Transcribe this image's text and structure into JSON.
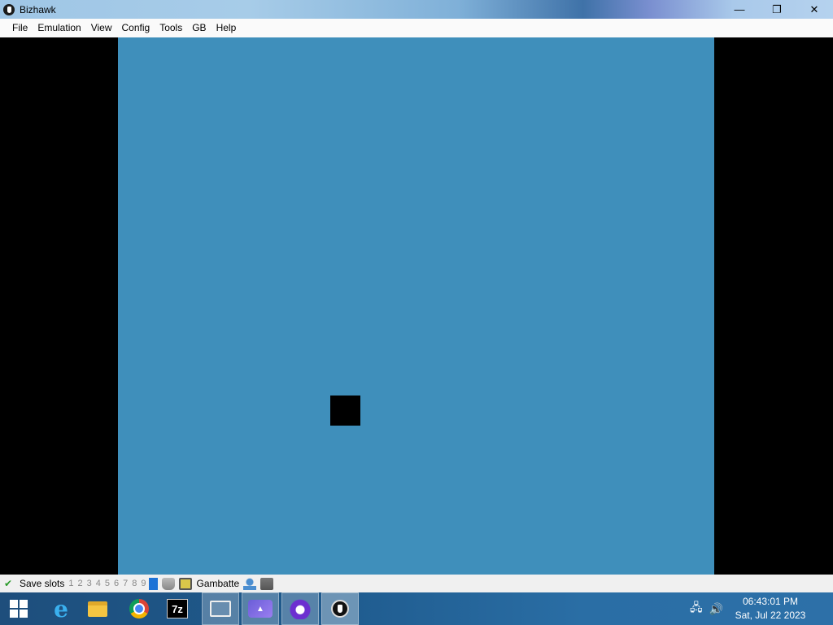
{
  "window": {
    "title": "Bizhawk",
    "controls": {
      "minimize": "—",
      "restore": "❐",
      "close": "✕"
    }
  },
  "menu": {
    "items": [
      "File",
      "Emulation",
      "View",
      "Config",
      "Tools",
      "GB",
      "Help"
    ]
  },
  "screen": {
    "background_color": "#3f8fbb"
  },
  "statusbar": {
    "save_label": "Save slots",
    "slots": [
      "1",
      "2",
      "3",
      "4",
      "5",
      "6",
      "7",
      "8",
      "9"
    ],
    "core_name": "Gambatte"
  },
  "taskbar": {
    "apps": [
      "start-button",
      "internet-explorer",
      "file-explorer",
      "chrome",
      "7-zip",
      "printer-app",
      "purple-app",
      "monster-app",
      "bizhawk"
    ],
    "time": "06:43:01 PM",
    "date": "Sat, Jul 22 2023"
  }
}
